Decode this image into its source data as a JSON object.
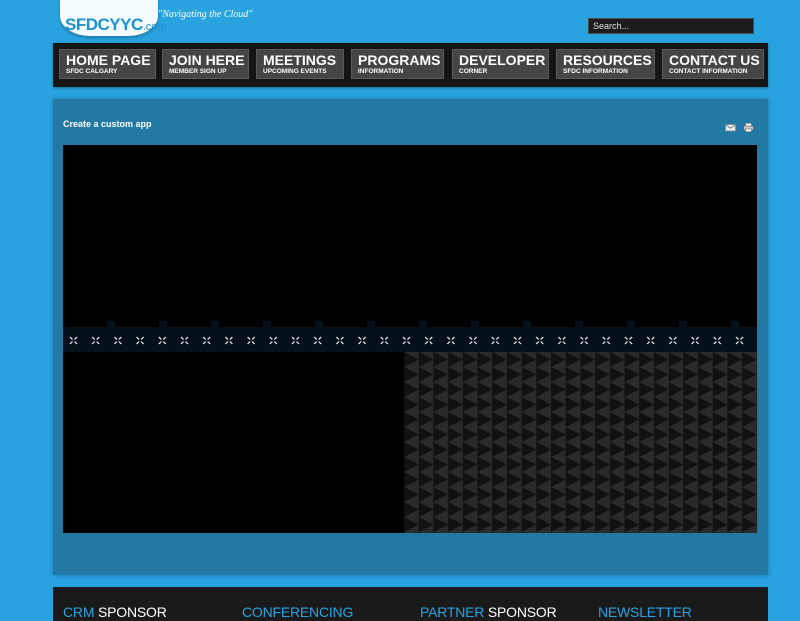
{
  "header": {
    "logo_main": "SFDCYYC",
    "logo_suffix": ".com",
    "tagline": "\"Navigating the Cloud\"",
    "search_placeholder": "Search..."
  },
  "nav": {
    "items": [
      {
        "label": "HOME PAGE",
        "sub": "SFDC CALGARY"
      },
      {
        "label": "JOIN HERE",
        "sub": "MEMBER SIGN UP"
      },
      {
        "label": "MEETINGS",
        "sub": "UPCOMING EVENTS"
      },
      {
        "label": "PROGRAMS",
        "sub": "INFORMATION"
      },
      {
        "label": "DEVELOPER",
        "sub": "CORNER"
      },
      {
        "label": "RESOURCES",
        "sub": "SFDC INFORMATION"
      },
      {
        "label": "CONTACT US",
        "sub": "CONTACT INFORMATION"
      }
    ]
  },
  "content": {
    "title": "Create a custom app",
    "email_icon": "email-icon",
    "print_icon": "print-icon"
  },
  "footer": {
    "headings": [
      {
        "blue": "CRM ",
        "white": "SPONSOR"
      },
      {
        "blue": "CONFERENCING",
        "white": ""
      },
      {
        "blue": "PARTNER ",
        "white": "SPONSOR"
      },
      {
        "blue": "NEWSLETTER",
        "white": ""
      }
    ]
  },
  "colors": {
    "page_background": "#29a3e0",
    "panel_background": "#2279a3",
    "nav_background": "#151515",
    "nav_button": "#454545",
    "footer_background": "#1a1a1a",
    "accent_blue": "#29a3e0"
  }
}
